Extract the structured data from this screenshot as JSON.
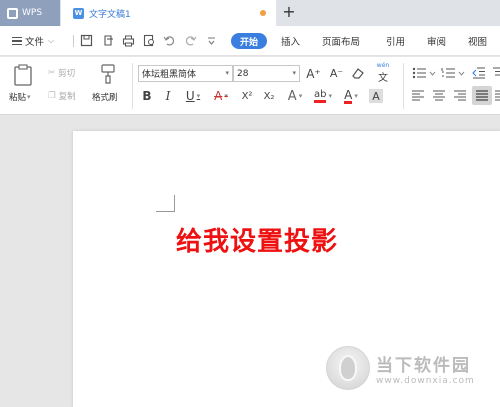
{
  "tabs": {
    "app_label": "WPS",
    "doc_title": "文字文稿1",
    "new_tab": "+"
  },
  "menubar": {
    "file": "文件",
    "file_arrow": "⌵",
    "start": "开始",
    "insert": "插入",
    "page_layout": "页面布局",
    "references": "引用",
    "review": "审阅",
    "view": "视图"
  },
  "ribbon": {
    "paste": "粘贴",
    "cut": "剪切",
    "copy": "复制",
    "format_painter": "格式刷",
    "font_family": "体坛粗黑简体",
    "font_size": "28",
    "bold": "B",
    "italic": "I",
    "underline": "U",
    "strike": "A",
    "superscript": "X²",
    "subscript": "X₂",
    "text_effect": "A",
    "highlight": "ab",
    "font_color": "A",
    "char_shading": "A",
    "grow_font": "A⁺",
    "shrink_font": "A⁻",
    "phonetic": "wén",
    "colors": {
      "strike": "#cc3333",
      "highlight": "#ee2222",
      "font_color": "#ee2222",
      "accent": "#3a7fe0"
    }
  },
  "document": {
    "text": "给我设置投影",
    "text_color": "#ee1111"
  },
  "watermark": {
    "name": "当下软件园",
    "url": "www.downxia.com"
  }
}
